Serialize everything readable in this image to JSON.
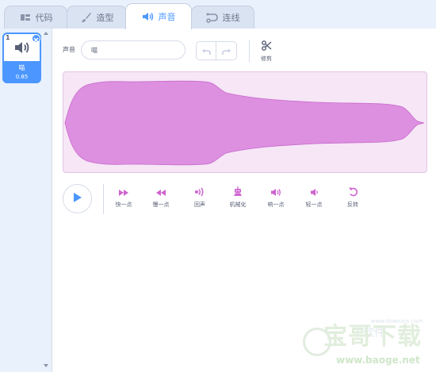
{
  "tabs": [
    {
      "label": "代码",
      "icon": "code-icon",
      "active": false
    },
    {
      "label": "造型",
      "icon": "brush-icon",
      "active": false
    },
    {
      "label": "声音",
      "icon": "speaker-icon",
      "active": true
    },
    {
      "label": "连线",
      "icon": "link-icon",
      "active": false
    }
  ],
  "sound_list": {
    "items": [
      {
        "number": "1",
        "name": "喵",
        "duration": "0.85",
        "icon": "speaker-icon",
        "selected": true
      }
    ]
  },
  "editor": {
    "name_label": "声音",
    "name_value": "喵",
    "trim_label": "修剪",
    "undo_icon": "undo-icon",
    "redo_icon": "redo-icon",
    "trim_icon": "scissors-icon"
  },
  "effects": [
    {
      "label": "快一点",
      "icon": "faster-icon"
    },
    {
      "label": "慢一点",
      "icon": "slower-icon"
    },
    {
      "label": "回声",
      "icon": "echo-icon"
    },
    {
      "label": "机械化",
      "icon": "robot-icon"
    },
    {
      "label": "响一点",
      "icon": "louder-icon"
    },
    {
      "label": "轻一点",
      "icon": "softer-icon"
    },
    {
      "label": "反转",
      "icon": "reverse-icon"
    }
  ],
  "watermark": {
    "big": "宝哥下载",
    "mid": "下软件",
    "small": "www.downxia.com",
    "url": "www.baoge.net"
  },
  "colors": {
    "accent": "#4c97ff",
    "effect": "#cf63cf",
    "wave_fill": "#dd8fe0",
    "wave_bg": "#f6e6f6"
  }
}
